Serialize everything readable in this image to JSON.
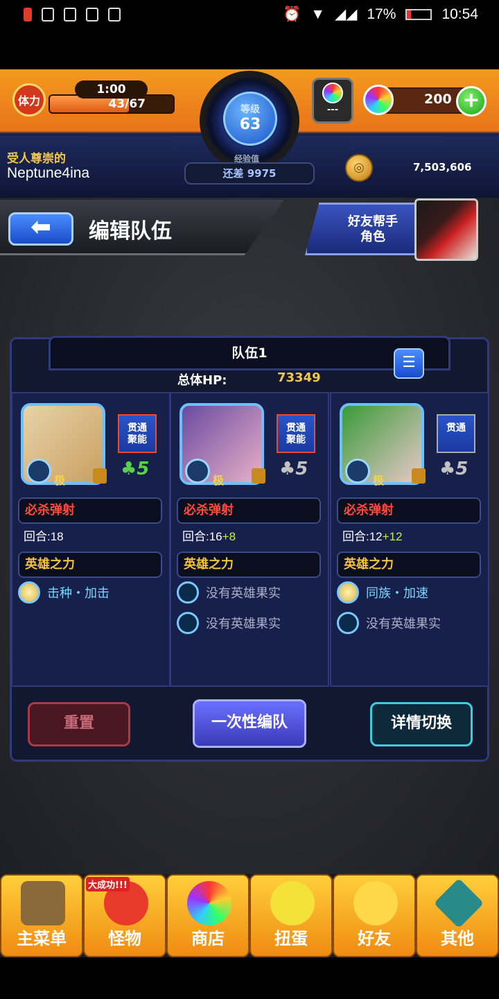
{
  "status_bar": {
    "battery": "17%",
    "time": "10:54"
  },
  "hud": {
    "stamina_label": "体力",
    "stamina_timer": "1:00",
    "stamina": "43/67",
    "level_label": "等级",
    "level": "63",
    "exp_label": "经验值",
    "exp_remaining": "还差 9975",
    "orb_slot": "---",
    "gems": "200",
    "plus_label": "+",
    "player_title": "受人尊崇的",
    "player_name": "Neptune4ina",
    "gold": "7,503,606"
  },
  "header": {
    "back_arrow": "⬅",
    "title": "编辑队伍",
    "friend_helper_line1": "好友帮手",
    "friend_helper_line2": "角色"
  },
  "team": {
    "name": "队伍1",
    "hp_label": "总体HP:",
    "hp_value": "73349",
    "members": [
      {
        "rank": "极",
        "ability_line1": "贯通",
        "ability_line2": "聚能",
        "luck": "♣5",
        "strike_label": "必杀弹射",
        "turns": "回合:18",
        "turn_bonus": "",
        "hero_label": "英雄之力",
        "fruit1": "击种・加击",
        "fruit2": ""
      },
      {
        "rank": "极",
        "ability_line1": "贯通",
        "ability_line2": "聚能",
        "luck": "♣5",
        "strike_label": "必杀弹射",
        "turns": "回合:16",
        "turn_bonus": "+8",
        "hero_label": "英雄之力",
        "fruit1": "没有英雄果实",
        "fruit2": "没有英雄果实"
      },
      {
        "rank": "极",
        "ability_line1": "贯通",
        "ability_line2": "",
        "luck": "♣5",
        "strike_label": "必杀弹射",
        "turns": "回合:12",
        "turn_bonus": "+12",
        "hero_label": "英雄之力",
        "fruit1": "同族・加速",
        "fruit2": "没有英雄果实"
      }
    ]
  },
  "actions": {
    "reset": "重置",
    "once": "一次性编队",
    "detail": "详情切换"
  },
  "nav": {
    "tag": "大成功!!!",
    "items": [
      "主菜单",
      "怪物",
      "商店",
      "扭蛋",
      "好友",
      "其他"
    ]
  },
  "colors": {
    "accent": "#f39a1e",
    "panel": "#16204a",
    "luck_green": "#59d24a"
  }
}
